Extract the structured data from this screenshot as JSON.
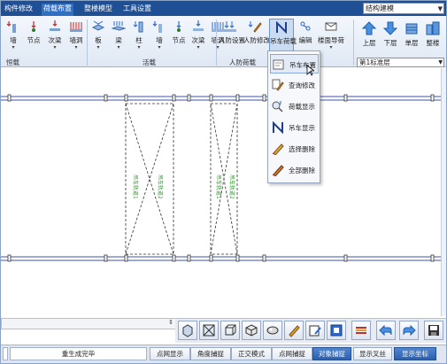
{
  "tabs": [
    "构件修改",
    "荷载布置",
    "整楼模型",
    "工具设置"
  ],
  "active_tab_index": 1,
  "top_combo": {
    "value": "结构建模"
  },
  "ribbon": {
    "buttons": [
      {
        "label": "墙",
        "icon": "wall-load-icon"
      },
      {
        "label": "节点",
        "icon": "node-load-icon"
      },
      {
        "label": "次梁",
        "icon": "secondary-beam-load-icon"
      },
      {
        "label": "墙洞",
        "icon": "wall-opening-load-icon"
      },
      {
        "label": "板",
        "icon": "slab-live-load-icon"
      },
      {
        "label": "梁",
        "icon": "beam-live-load-icon"
      },
      {
        "label": "柱",
        "icon": "column-live-load-icon"
      },
      {
        "label": "墙",
        "icon": "wall-live-load-icon"
      },
      {
        "label": "节点",
        "icon": "node-live-load-icon"
      },
      {
        "label": "次梁",
        "icon": "secondary-beam-live-load-icon"
      },
      {
        "label": "墙洞",
        "icon": "wall-opening-live-load-icon"
      },
      {
        "label": "人防设置",
        "icon": "civil-defense-settings-icon"
      },
      {
        "label": "人防修改",
        "icon": "civil-defense-modify-icon"
      },
      {
        "label": "吊车荷载",
        "icon": "crane-load-icon"
      },
      {
        "label": "编辑",
        "icon": "edit-icon"
      },
      {
        "label": "楼面导荷",
        "icon": "floor-load-transfer-icon"
      }
    ],
    "groups": [
      "恒载",
      "活载",
      "人防荷载"
    ],
    "nav": [
      {
        "label": "上层",
        "icon": "up-floor-icon"
      },
      {
        "label": "下层",
        "icon": "down-floor-icon"
      },
      {
        "label": "单层",
        "icon": "single-floor-icon"
      },
      {
        "label": "整楼",
        "icon": "whole-building-icon"
      }
    ],
    "floor_select": "第1标准层"
  },
  "popup_menu": {
    "items": [
      {
        "label": "吊车布置",
        "icon": "crane-layout-icon"
      },
      {
        "label": "查询修改",
        "icon": "query-modify-icon"
      },
      {
        "label": "荷载显示",
        "icon": "load-display-icon"
      },
      {
        "label": "吊车显示",
        "icon": "crane-display-icon"
      },
      {
        "label": "选择删除",
        "icon": "select-delete-icon"
      },
      {
        "label": "全部删除",
        "icon": "delete-all-icon"
      }
    ],
    "highlighted_index": 0
  },
  "canvas_labels": {
    "col1": "吊车轨道1",
    "col2": "吊车轨道2"
  },
  "bottom_tools": [
    {
      "icon": "view-3d-front-icon"
    },
    {
      "icon": "view-plan-icon"
    },
    {
      "icon": "view-box-icon"
    },
    {
      "icon": "view-iso-icon"
    },
    {
      "icon": "view-render-icon"
    },
    {
      "icon": "paint-icon"
    },
    {
      "icon": "edit-note-icon"
    },
    {
      "icon": "grid-select-icon"
    },
    {
      "icon": "dimension-icon"
    },
    {
      "icon": "undo-icon"
    },
    {
      "icon": "redo-icon"
    },
    {
      "icon": "save-icon"
    }
  ],
  "statusbar": {
    "left_text": "",
    "message": "重生成完毕",
    "buttons": [
      {
        "label": "点网显示",
        "on": false
      },
      {
        "label": "角度捕捉",
        "on": false
      },
      {
        "label": "正交模式",
        "on": false
      },
      {
        "label": "点网捕捉",
        "on": false
      },
      {
        "label": "对象捕捉",
        "on": true
      },
      {
        "label": "显示叉丝",
        "on": false
      },
      {
        "label": "显示坐标",
        "on": true
      }
    ]
  },
  "colors": {
    "tabbar": "#1f4f94",
    "ribbon": "#dfe8f4",
    "grid_line": "#3a56a8",
    "dashed": "#333333",
    "green_text": "#2e9b2e",
    "status_on": "#2a5fae"
  }
}
